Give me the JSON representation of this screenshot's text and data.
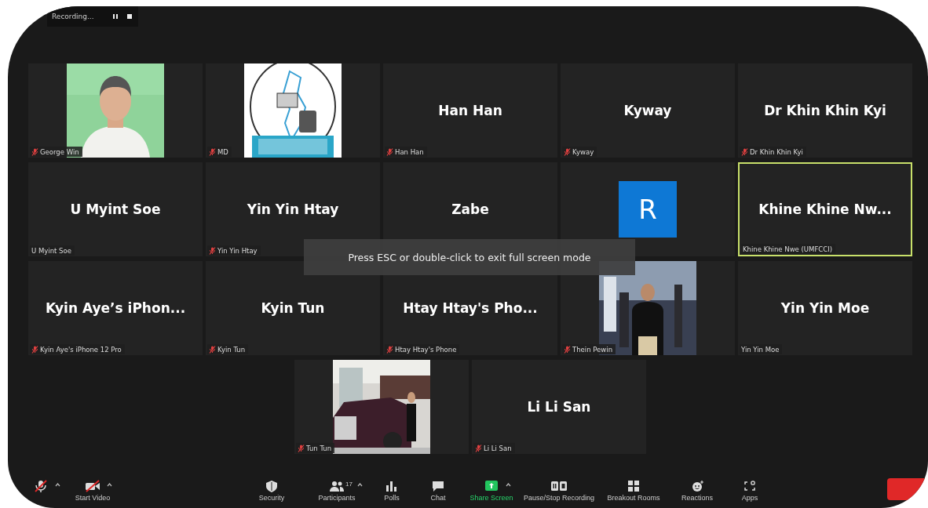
{
  "recording": {
    "label": "Recording..."
  },
  "tiles": [
    {
      "kind": "video",
      "label": "George Win",
      "muted": true,
      "active_speaker": false
    },
    {
      "kind": "logo",
      "label": "MD",
      "muted": true,
      "active_speaker": false
    },
    {
      "kind": "name",
      "display": "Han Han",
      "label": "Han Han",
      "muted": true,
      "active_speaker": false
    },
    {
      "kind": "name",
      "display": "Kyway",
      "label": "Kyway",
      "muted": true,
      "active_speaker": false
    },
    {
      "kind": "name",
      "display": "Dr Khin Khin Kyi",
      "label": "Dr Khin Khin Kyi",
      "muted": true,
      "active_speaker": false
    },
    {
      "kind": "name",
      "display": "U Myint Soe",
      "label": "U Myint Soe",
      "muted": false,
      "active_speaker": false
    },
    {
      "kind": "name",
      "display": "Yin Yin Htay",
      "label": "Yin Yin Htay",
      "muted": true,
      "active_speaker": false
    },
    {
      "kind": "name",
      "display": "Zabe",
      "active_speaker": false
    },
    {
      "kind": "avatar",
      "initial": "R",
      "active_speaker": false
    },
    {
      "kind": "name",
      "display": "Khine Khine Nw...",
      "label": "Khine Khine Nwe (UMFCCI)",
      "muted": false,
      "active_speaker": true
    },
    {
      "kind": "name",
      "display": "Kyin Aye’s iPhon...",
      "label": "Kyin Aye's iPhone 12 Pro",
      "muted": true,
      "active_speaker": false
    },
    {
      "kind": "name",
      "display": "Kyin Tun",
      "label": "Kyin Tun",
      "muted": true,
      "active_speaker": false
    },
    {
      "kind": "name",
      "display": "Htay Htay's Pho...",
      "label": "Htay Htay's Phone",
      "muted": true,
      "active_speaker": false
    },
    {
      "kind": "video",
      "label": "Thein Pewin",
      "muted": true,
      "active_speaker": false
    },
    {
      "kind": "name",
      "display": "Yin Yin Moe",
      "label": "Yin Yin Moe",
      "muted": false,
      "active_speaker": false
    },
    {
      "kind": "video",
      "label": "Tun Tun",
      "muted": true,
      "active_speaker": false
    },
    {
      "kind": "name",
      "display": "Li Li San",
      "label": "Li Li San",
      "muted": true,
      "active_speaker": false
    }
  ],
  "toast": "Press ESC or double-click to exit full screen mode",
  "toolbar": {
    "left": [
      {
        "kind": "mic",
        "caret": true,
        "highlight": false
      },
      {
        "kind": "video",
        "label": "Start Video",
        "caret": true,
        "highlight": false
      }
    ],
    "center": [
      {
        "kind": "security",
        "label": "Security",
        "caret": false,
        "highlight": false
      },
      {
        "kind": "participants",
        "label": "Participants",
        "badge": "17",
        "caret": true,
        "highlight": false
      },
      {
        "kind": "polls",
        "label": "Polls",
        "caret": false,
        "highlight": false
      },
      {
        "kind": "chat",
        "label": "Chat",
        "caret": false,
        "highlight": false
      },
      {
        "kind": "share",
        "label": "Share Screen",
        "caret": true,
        "highlight": true
      },
      {
        "kind": "recording",
        "label": "Pause/Stop Recording",
        "caret": false,
        "highlight": false
      },
      {
        "kind": "breakout",
        "label": "Breakout Rooms",
        "caret": false,
        "highlight": false
      },
      {
        "kind": "reactions",
        "label": "Reactions",
        "caret": false,
        "highlight": false
      },
      {
        "kind": "apps",
        "label": "Apps",
        "caret": false,
        "highlight": false
      }
    ]
  }
}
